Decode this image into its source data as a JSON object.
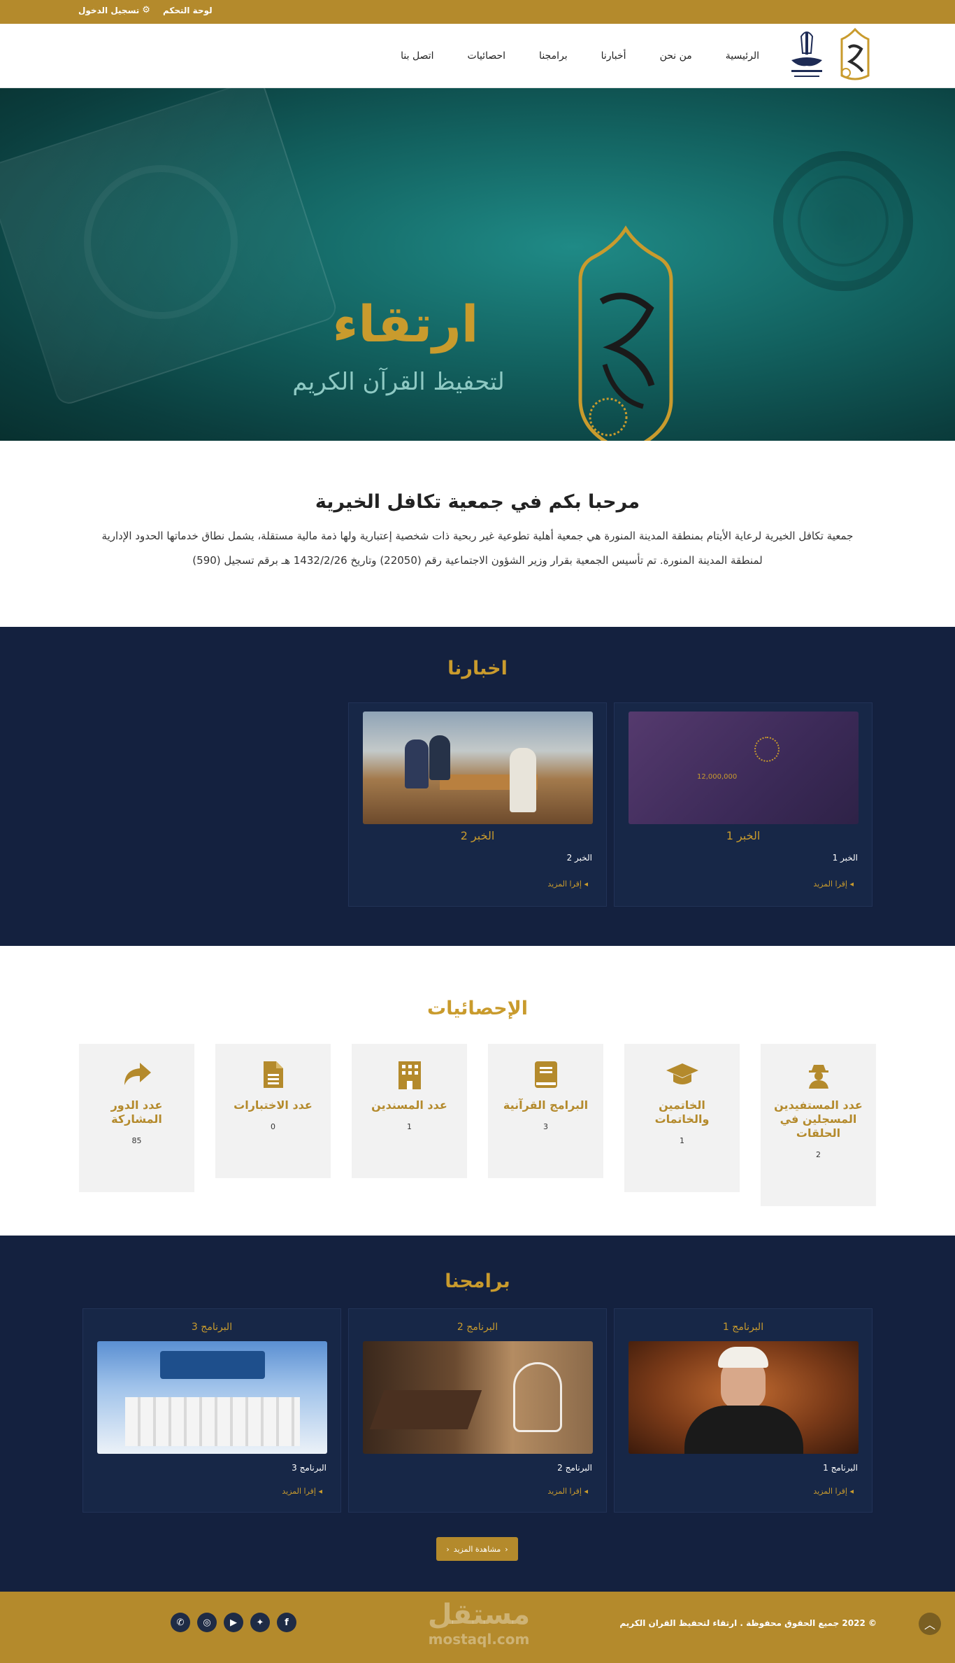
{
  "topbar": {
    "control_panel": "لوحة التحكم",
    "login": "تسجيل الدخول"
  },
  "nav": {
    "items": [
      "الرئيسية",
      "من نحن",
      "أخبارنا",
      "برامجنا",
      "احصائيات",
      "اتصل بنا"
    ]
  },
  "hero": {
    "title": "ارتقاء",
    "subtitle": "لتحفيظ القرآن الكريم"
  },
  "welcome": {
    "title": "مرحبا بكم في جمعية تكافل الخيرية",
    "text": "جمعية تكافل الخيرية لرعاية الأيتام بمنطقة المدينة المنورة هي جمعية أهلية تطوعية غير ربحية ذات شخصية إعتبارية ولها ذمة مالية مستقلة، يشمل نطاق خدماتها الحدود الإدارية لمنطقة المدينة المنورة. تم تأسيس الجمعية بقرار وزير الشؤون الاجتماعية رقم (22050) وتاريخ 1432/2/26 هـ برقم تسجيل (590)"
  },
  "news": {
    "title": "اخبارنا",
    "items": [
      {
        "title": "الخبر 1",
        "desc": "الخبر 1",
        "more": "إقرا المزيد",
        "image_text": "12,000,000"
      },
      {
        "title": "الخبر 2",
        "desc": "الخبر 2",
        "more": "إقرا المزيد"
      }
    ]
  },
  "stats": {
    "title": "الإحصائيات",
    "items": [
      {
        "label": "عدد المستفيدين المسجلين في الحلقات",
        "value": "2",
        "icon": "user-secret-icon"
      },
      {
        "label": "الخاتمين والخاتمات",
        "value": "1",
        "icon": "graduation-cap-icon"
      },
      {
        "label": "البرامج القرآنية",
        "value": "3",
        "icon": "book-icon"
      },
      {
        "label": "عدد المسندين",
        "value": "1",
        "icon": "building-icon"
      },
      {
        "label": "عدد الاختبارات",
        "value": "0",
        "icon": "file-icon"
      },
      {
        "label": "عدد الدور المشاركة",
        "value": "85",
        "icon": "share-icon"
      }
    ]
  },
  "programs": {
    "title": "برامجنا",
    "items": [
      {
        "title": "البرنامج 1",
        "desc": "البرنامج 1",
        "more": "إقرا المزيد"
      },
      {
        "title": "البرنامج 2",
        "desc": "البرنامج 2",
        "more": "إقرا المزيد"
      },
      {
        "title": "البرنامج 3",
        "desc": "البرنامج 3",
        "more": "إقرا المزيد"
      }
    ],
    "see_more": "مشاهدة المزيد"
  },
  "footer": {
    "copyright": "© 2022 جميع الحقوق محفوظة . ارتقاء لتحفيظ القران الكريم",
    "watermark_ar": "مستقل",
    "watermark_en": "mostaql.com",
    "socials": [
      "whatsapp-icon",
      "instagram-icon",
      "youtube-icon",
      "twitter-icon",
      "facebook-icon"
    ]
  },
  "colors": {
    "gold": "#b48a2c",
    "navy": "#14213f",
    "teal": "#12605e"
  }
}
